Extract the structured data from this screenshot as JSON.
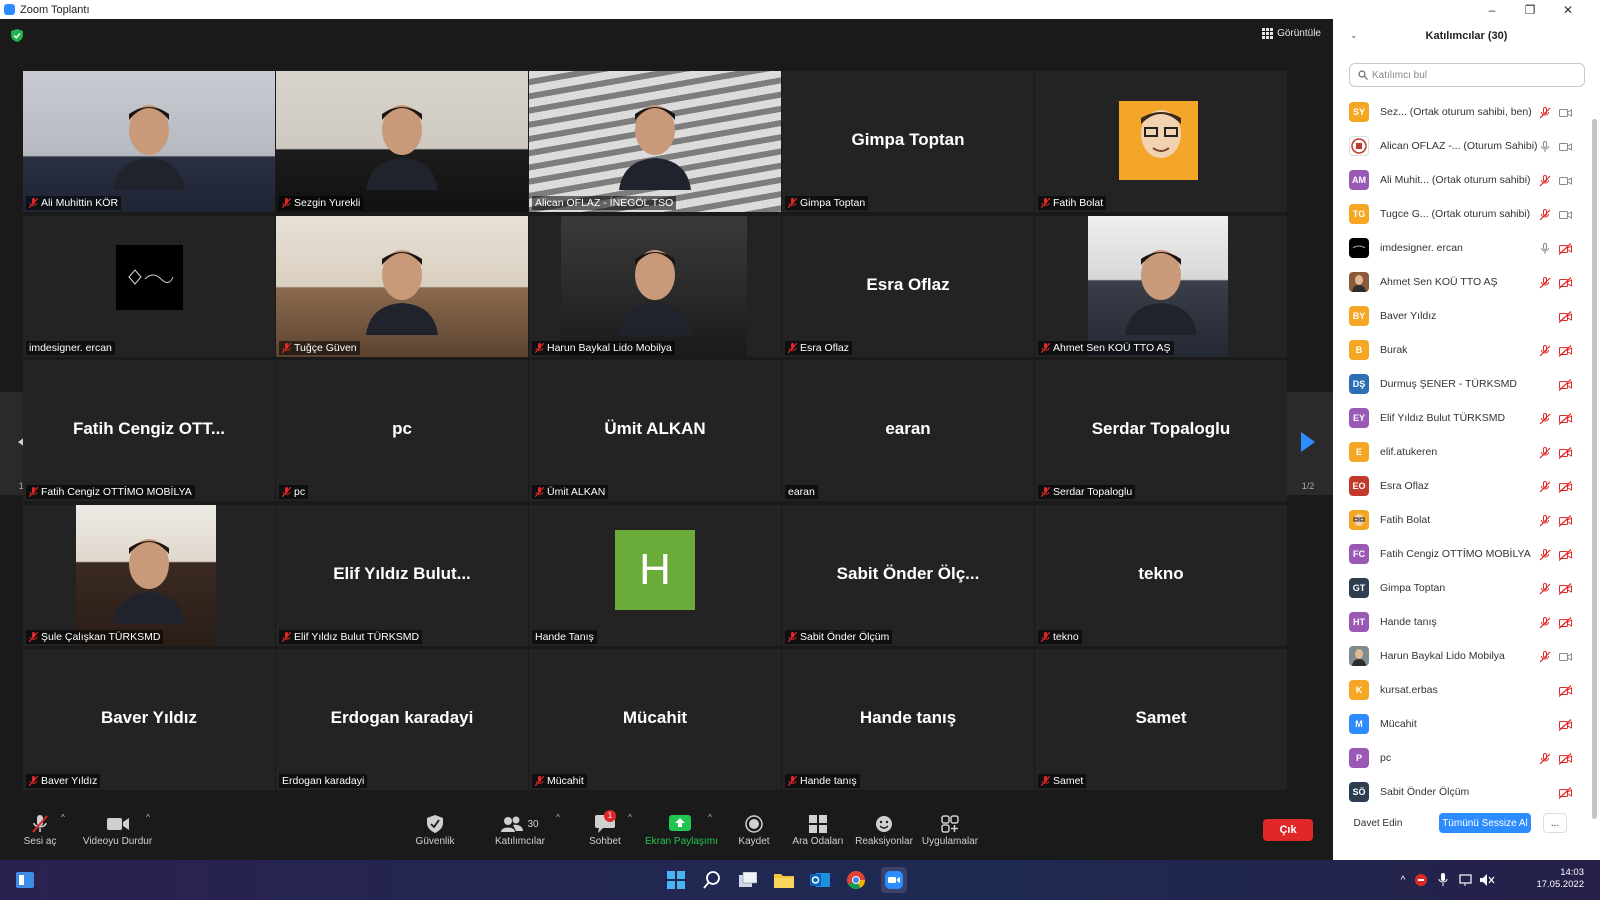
{
  "window": {
    "title": "Zoom Toplantı"
  },
  "meeting": {
    "view_label": "Görüntüle",
    "page_indicator_left": "1/2",
    "page_indicator_right": "1/2",
    "tiles": [
      {
        "label": "Ali Muhittin KÖR",
        "display": "",
        "kind": "photo",
        "muted": true
      },
      {
        "label": "Sezgin Yurekli",
        "display": "",
        "kind": "photo",
        "muted": true
      },
      {
        "label": "Alican OFLAZ - İNEGÖL TSO",
        "display": "",
        "kind": "photo",
        "muted": false,
        "active": true
      },
      {
        "label": "Gimpa Toptan",
        "display": "Gimpa Toptan",
        "kind": "name",
        "muted": true
      },
      {
        "label": "Fatih Bolat",
        "display": "",
        "kind": "cartoon",
        "muted": true
      },
      {
        "label": "imdesigner. ercan",
        "display": "",
        "kind": "logo",
        "muted": false
      },
      {
        "label": "Tuğçe Güven",
        "display": "",
        "kind": "photo",
        "muted": true
      },
      {
        "label": "Harun Baykal Lido Mobilya",
        "display": "",
        "kind": "photo",
        "muted": true
      },
      {
        "label": "Esra Oflaz",
        "display": "Esra Oflaz",
        "kind": "name",
        "muted": true
      },
      {
        "label": "Ahmet Sen KOÜ TTO AŞ",
        "display": "",
        "kind": "photo",
        "muted": true
      },
      {
        "label": "Fatih Cengiz OTTİMO MOBİLYA",
        "display": "Fatih Cengiz OTT...",
        "kind": "name",
        "muted": true
      },
      {
        "label": "pc",
        "display": "pc",
        "kind": "name",
        "muted": true
      },
      {
        "label": "Ümit ALKAN",
        "display": "Ümit ALKAN",
        "kind": "name",
        "muted": true
      },
      {
        "label": "earan",
        "display": "earan",
        "kind": "name",
        "muted": false
      },
      {
        "label": "Serdar Topaloglu",
        "display": "Serdar Topaloglu",
        "kind": "name",
        "muted": true
      },
      {
        "label": "Şule Çalışkan TÜRKSMD",
        "display": "",
        "kind": "photo",
        "muted": true
      },
      {
        "label": "Elif Yıldız Bulut TÜRKSMD",
        "display": "Elif Yıldız Bulut...",
        "kind": "name",
        "muted": true
      },
      {
        "label": "Hande Tanış",
        "display": "H",
        "kind": "letter",
        "muted": false
      },
      {
        "label": "Sabit Önder Ölçüm",
        "display": "Sabit Önder Ölç...",
        "kind": "name",
        "muted": true
      },
      {
        "label": "tekno",
        "display": "tekno",
        "kind": "name",
        "muted": true
      },
      {
        "label": "Baver Yıldız",
        "display": "Baver Yıldız",
        "kind": "name",
        "muted": true
      },
      {
        "label": "Erdogan karadayi",
        "display": "Erdogan karadayi",
        "kind": "name",
        "muted": false
      },
      {
        "label": "Mücahit",
        "display": "Mücahit",
        "kind": "name",
        "muted": true
      },
      {
        "label": "Hande tanış",
        "display": "Hande tanış",
        "kind": "name",
        "muted": true
      },
      {
        "label": "Samet",
        "display": "Samet",
        "kind": "name",
        "muted": true
      }
    ]
  },
  "toolbar": {
    "unmute": "Sesi aç",
    "stop_video": "Videoyu Durdur",
    "security": "Güvenlik",
    "participants": "Katılımcılar",
    "participants_count": "30",
    "chat": "Sohbet",
    "chat_badge": "1",
    "share": "Ekran Paylaşımı",
    "record": "Kaydet",
    "breakout": "Ara Odaları",
    "reactions": "Reaksiyonlar",
    "apps": "Uygulamalar",
    "leave": "Çık"
  },
  "panel": {
    "title": "Katılımcılar (30)",
    "search_placeholder": "Katılımcı bul",
    "participants": [
      {
        "initials": "SY",
        "color": "#f5a623",
        "name": "Sez...  (Ortak oturum sahibi, ben)",
        "mic": "muted",
        "video": "off-gray"
      },
      {
        "initials": "",
        "color": "#ffffff",
        "avatar": "logo-red",
        "name": "Alican OFLAZ -...  (Oturum Sahibi)",
        "mic": "on",
        "video": "off-gray"
      },
      {
        "initials": "AM",
        "color": "#9b59b6",
        "name": "Ali Muhit...  (Ortak oturum sahibi)",
        "mic": "muted",
        "video": "off-gray"
      },
      {
        "initials": "TG",
        "color": "#f5a623",
        "name": "Tugce G...  (Ortak oturum sahibi)",
        "mic": "muted",
        "video": "off-gray"
      },
      {
        "initials": "",
        "color": "#000000",
        "avatar": "dark-logo",
        "name": "imdesigner. ercan",
        "mic": "on",
        "video": "muted"
      },
      {
        "initials": "",
        "color": "#8a5a3a",
        "avatar": "photo",
        "name": "Ahmet Sen KOÜ TTO AŞ",
        "mic": "muted",
        "video": "muted"
      },
      {
        "initials": "BY",
        "color": "#f5a623",
        "name": "Baver Yıldız",
        "mic": "none",
        "video": "muted"
      },
      {
        "initials": "B",
        "color": "#f5a623",
        "name": "Burak",
        "mic": "muted",
        "video": "muted"
      },
      {
        "initials": "DŞ",
        "color": "#2d6fb5",
        "name": "Durmuş ŞENER - TÜRKSMD",
        "mic": "none",
        "video": "muted"
      },
      {
        "initials": "EY",
        "color": "#9b59b6",
        "name": "Elif Yıldız Bulut TÜRKSMD",
        "mic": "muted",
        "video": "muted"
      },
      {
        "initials": "E",
        "color": "#f5a623",
        "name": "elif.atukeren",
        "mic": "muted",
        "video": "muted"
      },
      {
        "initials": "EO",
        "color": "#c0392b",
        "name": "Esra Oflaz",
        "mic": "muted",
        "video": "muted"
      },
      {
        "initials": "",
        "color": "#f5a623",
        "avatar": "cartoon",
        "name": "Fatih Bolat",
        "mic": "muted",
        "video": "muted"
      },
      {
        "initials": "FC",
        "color": "#9b59b6",
        "name": "Fatih Cengiz OTTİMO MOBİLYA",
        "mic": "muted",
        "video": "muted"
      },
      {
        "initials": "GT",
        "color": "#2c3e50",
        "name": "Gimpa Toptan",
        "mic": "muted",
        "video": "muted"
      },
      {
        "initials": "HT",
        "color": "#9b59b6",
        "name": "Hande tanış",
        "mic": "muted",
        "video": "muted"
      },
      {
        "initials": "",
        "color": "#7f8c8d",
        "avatar": "photo",
        "name": "Harun Baykal Lido Mobilya",
        "mic": "muted",
        "video": "off-gray"
      },
      {
        "initials": "K",
        "color": "#f5a623",
        "name": "kursat.erbas",
        "mic": "none",
        "video": "muted"
      },
      {
        "initials": "M",
        "color": "#2d8cff",
        "name": "Mücahit",
        "mic": "none",
        "video": "muted"
      },
      {
        "initials": "P",
        "color": "#9b59b6",
        "name": "pc",
        "mic": "muted",
        "video": "muted"
      },
      {
        "initials": "SÖ",
        "color": "#2c3e50",
        "name": "Sabit Önder Ölçüm",
        "mic": "none",
        "video": "muted"
      }
    ],
    "invite": "Davet Edin",
    "mute_all": "Tümünü Sessize Al",
    "more": "..."
  },
  "taskbar": {
    "time": "14:03",
    "date": "17.05.2022"
  },
  "colors": {
    "zoom_blue": "#2d8cff",
    "leave_red": "#e02828",
    "muted_red": "#e02828",
    "active_border": "#e2e86c"
  }
}
